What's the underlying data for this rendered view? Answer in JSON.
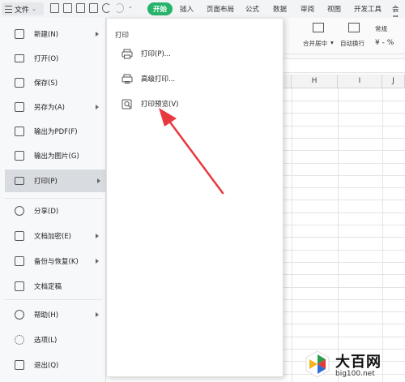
{
  "topbar": {
    "file_label": "文件",
    "tabs": [
      "开始",
      "插入",
      "页面布局",
      "公式",
      "数据",
      "审阅",
      "视图",
      "开发工具",
      "会员"
    ]
  },
  "ribbon": {
    "merge_label": "合并居中",
    "wrap_label": "自动换行",
    "format_label": "常规",
    "currency_label": "¥ - %"
  },
  "grid": {
    "columns": [
      "H",
      "I",
      "J"
    ]
  },
  "file_menu": {
    "items": [
      {
        "label": "新建(N)",
        "icon": "new-file-icon",
        "submenu": true
      },
      {
        "label": "打开(O)",
        "icon": "folder-open-icon",
        "submenu": false
      },
      {
        "label": "保存(S)",
        "icon": "save-icon",
        "submenu": false
      },
      {
        "label": "另存为(A)",
        "icon": "save-as-icon",
        "submenu": true
      },
      {
        "label": "输出为PDF(F)",
        "icon": "pdf-icon",
        "submenu": false
      },
      {
        "label": "输出为图片(G)",
        "icon": "image-icon",
        "submenu": false
      },
      {
        "label": "打印(P)",
        "icon": "printer-icon",
        "submenu": true,
        "selected": true
      },
      {
        "label": "分享(D)",
        "icon": "share-icon",
        "submenu": false
      },
      {
        "label": "文档加密(E)",
        "icon": "encrypt-icon",
        "submenu": true
      },
      {
        "label": "备份与恢复(K)",
        "icon": "backup-icon",
        "submenu": true
      },
      {
        "label": "文档定稿",
        "icon": "finalize-icon",
        "submenu": false
      },
      {
        "label": "帮助(H)",
        "icon": "help-icon",
        "submenu": true
      },
      {
        "label": "选项(L)",
        "icon": "gear-icon",
        "submenu": false
      },
      {
        "label": "退出(Q)",
        "icon": "exit-icon",
        "submenu": false
      }
    ]
  },
  "print_submenu": {
    "title": "打印",
    "items": [
      {
        "label": "打印(P)...",
        "icon": "printer-icon"
      },
      {
        "label": "高级打印...",
        "icon": "advanced-print-icon"
      },
      {
        "label": "打印预览(V)",
        "icon": "print-preview-icon"
      }
    ]
  },
  "watermark": {
    "title": "大百网",
    "url": "big100.net"
  },
  "colors": {
    "accent": "#27b36a",
    "arrow": "#e8393f",
    "selected_bg": "#d8dbe0"
  }
}
